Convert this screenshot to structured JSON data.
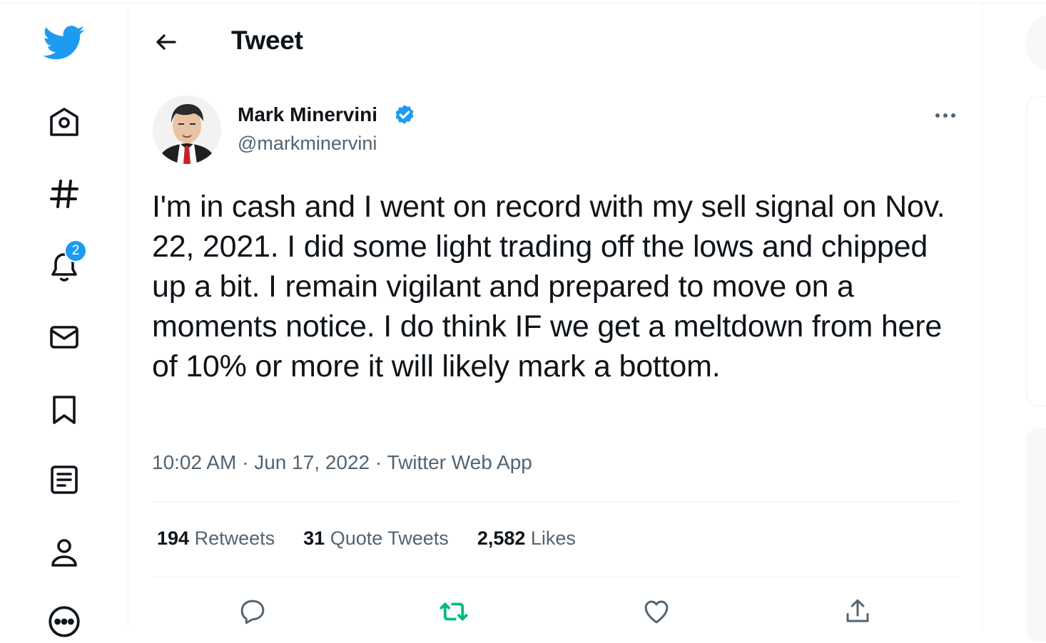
{
  "header": {
    "title": "Tweet"
  },
  "nav": {
    "notifications_badge": "2"
  },
  "author": {
    "name": "Mark Minervini",
    "handle": "@markminervini"
  },
  "tweet": {
    "text": "I'm in cash and I went on record with my sell signal on Nov. 22, 2021. I did some light trading off the lows and chipped up a bit. I remain vigilant and prepared to move on a moments notice. I do think IF we get a meltdown from here of 10% or more it will likely mark a bottom.",
    "time": "10:02 AM",
    "date": "Jun 17, 2022",
    "source": "Twitter Web App"
  },
  "stats": {
    "retweets_count": "194",
    "retweets_label": "Retweets",
    "quotes_count": "31",
    "quotes_label": "Quote Tweets",
    "likes_count": "2,582",
    "likes_label": "Likes"
  },
  "colors": {
    "accent": "#1d9bf0",
    "retweet_green": "#00ba7c",
    "muted": "#536471"
  }
}
